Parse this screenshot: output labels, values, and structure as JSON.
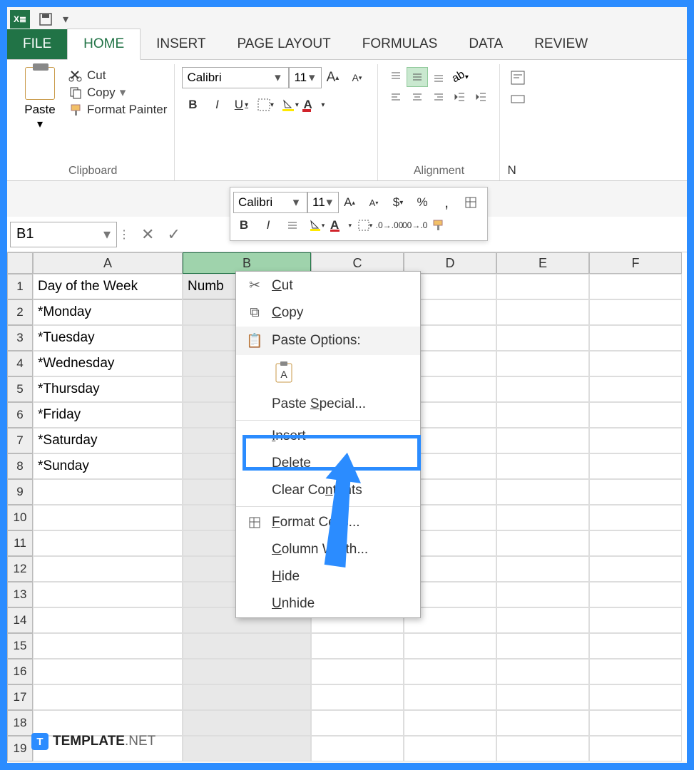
{
  "tabs": {
    "file": "FILE",
    "home": "HOME",
    "insert": "INSERT",
    "pagelayout": "PAGE LAYOUT",
    "formulas": "FORMULAS",
    "data": "DATA",
    "review": "REVIEW"
  },
  "ribbon": {
    "paste": "Paste",
    "cut": "Cut",
    "copy": "Copy",
    "formatpainter": "Format Painter",
    "clipboard_label": "Clipboard",
    "font_name": "Calibri",
    "font_size": "11",
    "alignment_label": "Alignment",
    "b": "B",
    "i": "I",
    "u": "U",
    "n": "N"
  },
  "mini": {
    "font": "Calibri",
    "size": "11"
  },
  "namebox": "B1",
  "columns": [
    "A",
    "B",
    "C",
    "D",
    "E",
    "F"
  ],
  "rows": [
    "1",
    "2",
    "3",
    "4",
    "5",
    "6",
    "7",
    "8",
    "9",
    "10",
    "11",
    "12",
    "13",
    "14",
    "15",
    "16",
    "17",
    "18",
    "19"
  ],
  "cells": {
    "A1": "Day of the Week",
    "B1": "Numb",
    "A2": "*Monday",
    "A3": "*Tuesday",
    "A4": "*Wednesday",
    "A5": "*Thursday",
    "A6": "*Friday",
    "A7": "*Saturday",
    "A8": "*Sunday"
  },
  "context": {
    "cut": "Cut",
    "copy": "Copy",
    "paste_options": "Paste Options:",
    "paste_special": "Paste Special...",
    "insert": "Insert",
    "delete": "Delete",
    "clear": "Clear Contents",
    "format_cells": "Format Cells...",
    "col_width": "Column Width...",
    "hide": "Hide",
    "unhide": "Unhide"
  },
  "watermark": {
    "brand": "TEMPLATE",
    "suffix": ".NET"
  }
}
